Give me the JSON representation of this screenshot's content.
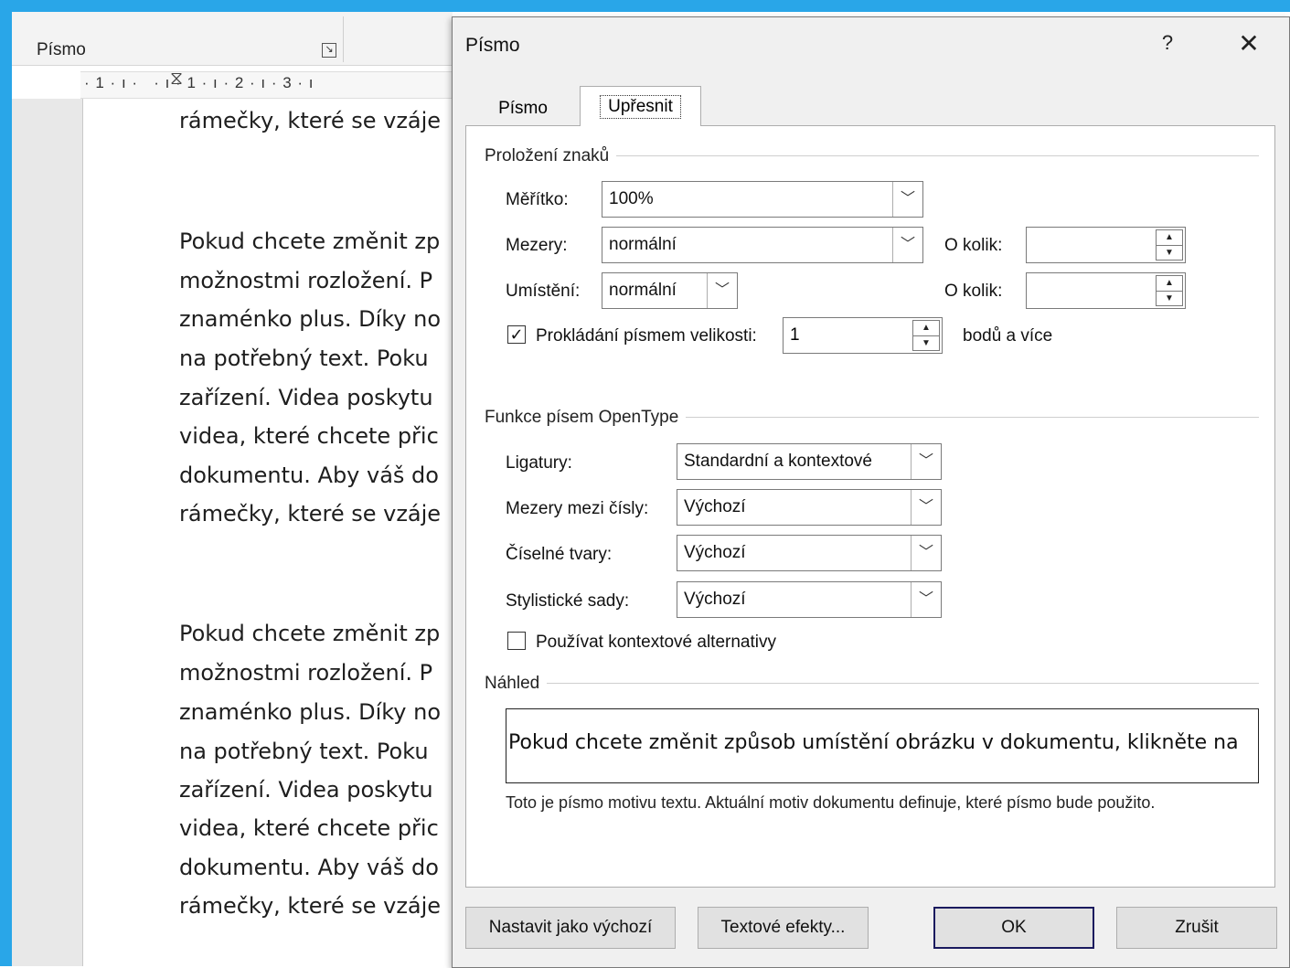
{
  "background_doc": {
    "ribbon_group_label": "Písmo",
    "ruler_text": "· 1 · ı ·   · ı · 1 · ı · 2 · ı · 3 · ı",
    "lines": [
      "rámečky, které se vzáje",
      "Pokud chcete změnit zp",
      "možnostmi rozložení. P",
      "znaménko plus. Díky no",
      "na potřebný text. Poku",
      "zařízení. Videa poskytu",
      "videa, které chcete přic",
      "dokumentu. Aby váš do",
      "rámečky, které se vzáje",
      "Pokud chcete změnit zp",
      "možnostmi rozložení. P",
      "znaménko plus. Díky no",
      "na potřebný text. Poku",
      "zařízení. Videa poskytu",
      "videa, které chcete přic",
      "dokumentu. Aby váš do",
      "rámečky, které se vzáje"
    ]
  },
  "dialog": {
    "title": "Písmo",
    "help": "?",
    "close": "✕",
    "tabs": {
      "font": "Písmo",
      "advanced": "Upřesnit"
    },
    "char_spacing": {
      "section": "Proložení znaků",
      "scale_label": "Měřítko:",
      "scale_value": "100%",
      "spacing_label": "Mezery:",
      "spacing_value": "normální",
      "spacing_by_label": "O kolik:",
      "spacing_by_value": "",
      "position_label": "Umístění:",
      "position_value": "normální",
      "position_by_label": "O kolik:",
      "position_by_value": "",
      "kerning_checked": true,
      "kerning_label": "Prokládání písmem velikosti:",
      "kerning_value": "1",
      "kerning_suffix": "bodů a více"
    },
    "opentype": {
      "section": "Funkce písem OpenType",
      "ligatures_label": "Ligatury:",
      "ligatures_value": "Standardní a kontextové",
      "number_spacing_label": "Mezery mezi čísly:",
      "number_spacing_value": "Výchozí",
      "number_forms_label": "Číselné tvary:",
      "number_forms_value": "Výchozí",
      "stylistic_sets_label": "Stylistické sady:",
      "stylistic_sets_value": "Výchozí",
      "contextual_checked": false,
      "contextual_label": "Používat kontextové alternativy"
    },
    "preview": {
      "section": "Náhled",
      "text": "Pokud chcete změnit způsob umístění obrázku v dokumentu, klikněte na",
      "note": "Toto je písmo motivu textu. Aktuální motiv dokumentu definuje, které písmo bude použito."
    },
    "buttons": {
      "set_default": "Nastavit jako výchozí",
      "text_effects": "Textové efekty...",
      "ok": "OK",
      "cancel": "Zrušit"
    }
  }
}
